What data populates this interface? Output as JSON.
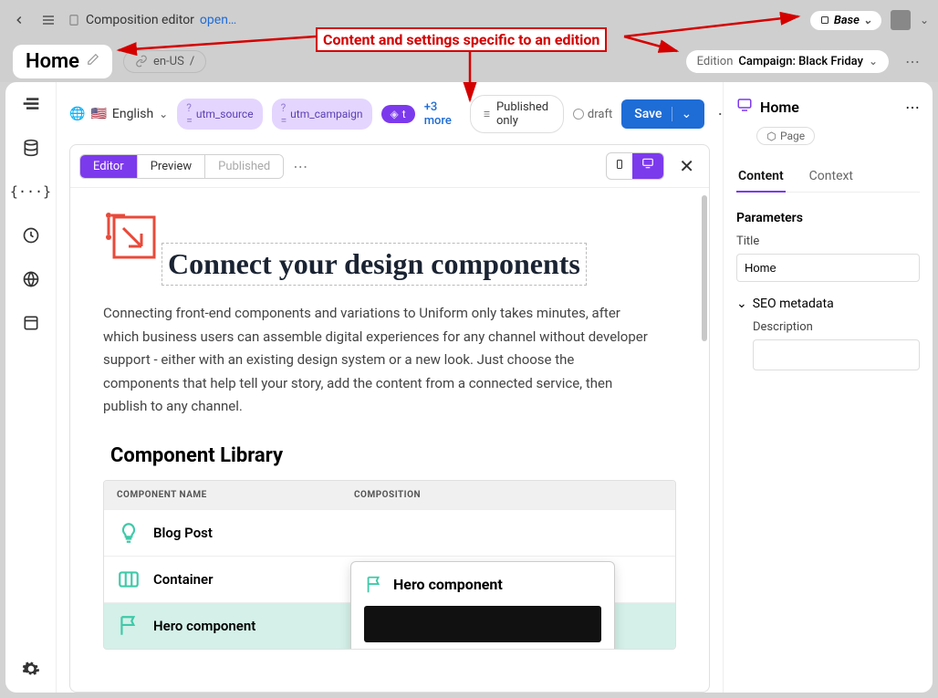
{
  "topbar": {
    "breadcrumb_title": "Composition editor",
    "breadcrumb_action": "open…",
    "base_label": "Base"
  },
  "secondbar": {
    "home_label": "Home",
    "locale": "en-US",
    "locale_prefix": "/",
    "edition_label": "Edition",
    "edition_value": "Campaign: Black Friday"
  },
  "annotation": {
    "text": "Content and settings specific to an edition"
  },
  "toolbar": {
    "language": "English",
    "chips": {
      "utm_source": "utm_source",
      "utm_campaign": "utm_campaign",
      "t": "t"
    },
    "more_link": "+3 more",
    "published_only": "Published only",
    "draft": "draft",
    "save": "Save"
  },
  "tabs": {
    "editor": "Editor",
    "preview": "Preview",
    "published": "Published"
  },
  "canvas": {
    "title": "Connect your design components",
    "body": "Connecting front-end components and variations to Uniform only takes minutes, after which business users can assemble digital experiences for any channel without developer support - either with an existing design system or a new look. Just choose the components that help tell your story, add the content from a connected service, then publish to any channel.",
    "complib_title": "Component Library",
    "headers": {
      "name": "COMPONENT NAME",
      "composition": "COMPOSITION"
    },
    "rows": [
      {
        "name": "Blog Post"
      },
      {
        "name": "Container"
      },
      {
        "name": "Hero component"
      }
    ],
    "hover_title": "Hero component"
  },
  "rightpanel": {
    "title": "Home",
    "badge": "Page",
    "tabs": {
      "content": "Content",
      "context": "Context"
    },
    "parameters_label": "Parameters",
    "title_field_label": "Title",
    "title_field_value": "Home",
    "seo_label": "SEO metadata",
    "description_label": "Description"
  }
}
